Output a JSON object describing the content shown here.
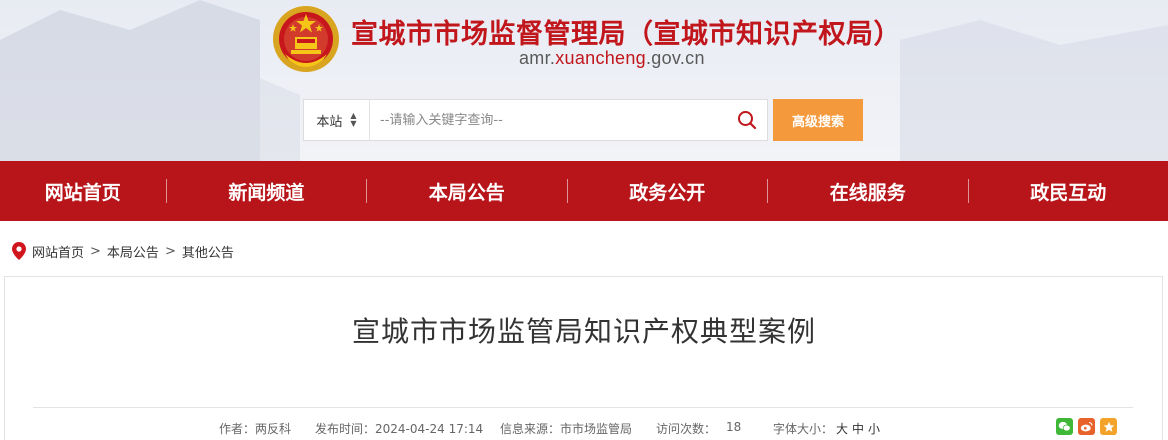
{
  "header": {
    "title": "宣城市市场监督管理局（宣城市知识产权局）",
    "domain_prefix": "amr.",
    "domain_highlight": "xuancheng",
    "domain_suffix": ".gov.cn",
    "emblem_icon": "national-emblem-icon"
  },
  "search": {
    "scope_value": "本站",
    "placeholder": "--请输入关键字查询--",
    "advanced_label": "高级搜索"
  },
  "nav": {
    "items": [
      "网站首页",
      "新闻频道",
      "本局公告",
      "政务公开",
      "在线服务",
      "政民互动"
    ]
  },
  "breadcrumb": {
    "items": [
      "网站首页",
      "本局公告",
      "其他公告"
    ],
    "separator": ">"
  },
  "article": {
    "title": "宣城市市场监管局知识产权典型案例",
    "author_label": "作者：",
    "author": "两反科",
    "publish_label": "发布时间：",
    "publish_time": "2024-04-24 17:14",
    "source_label": "信息来源：",
    "source": "市市场监管局",
    "visits_label": "访问次数：",
    "visits": "18",
    "font_size_label": "字体大小：",
    "font_large": "大",
    "font_medium": "中",
    "font_small": "小"
  },
  "colors": {
    "brand_red": "#b8151b",
    "title_red": "#c0161c",
    "orange": "#f59a3c",
    "wechat_green": "#3fb837",
    "weibo_orange": "#e8632b",
    "star_orange": "#f3a32a"
  }
}
